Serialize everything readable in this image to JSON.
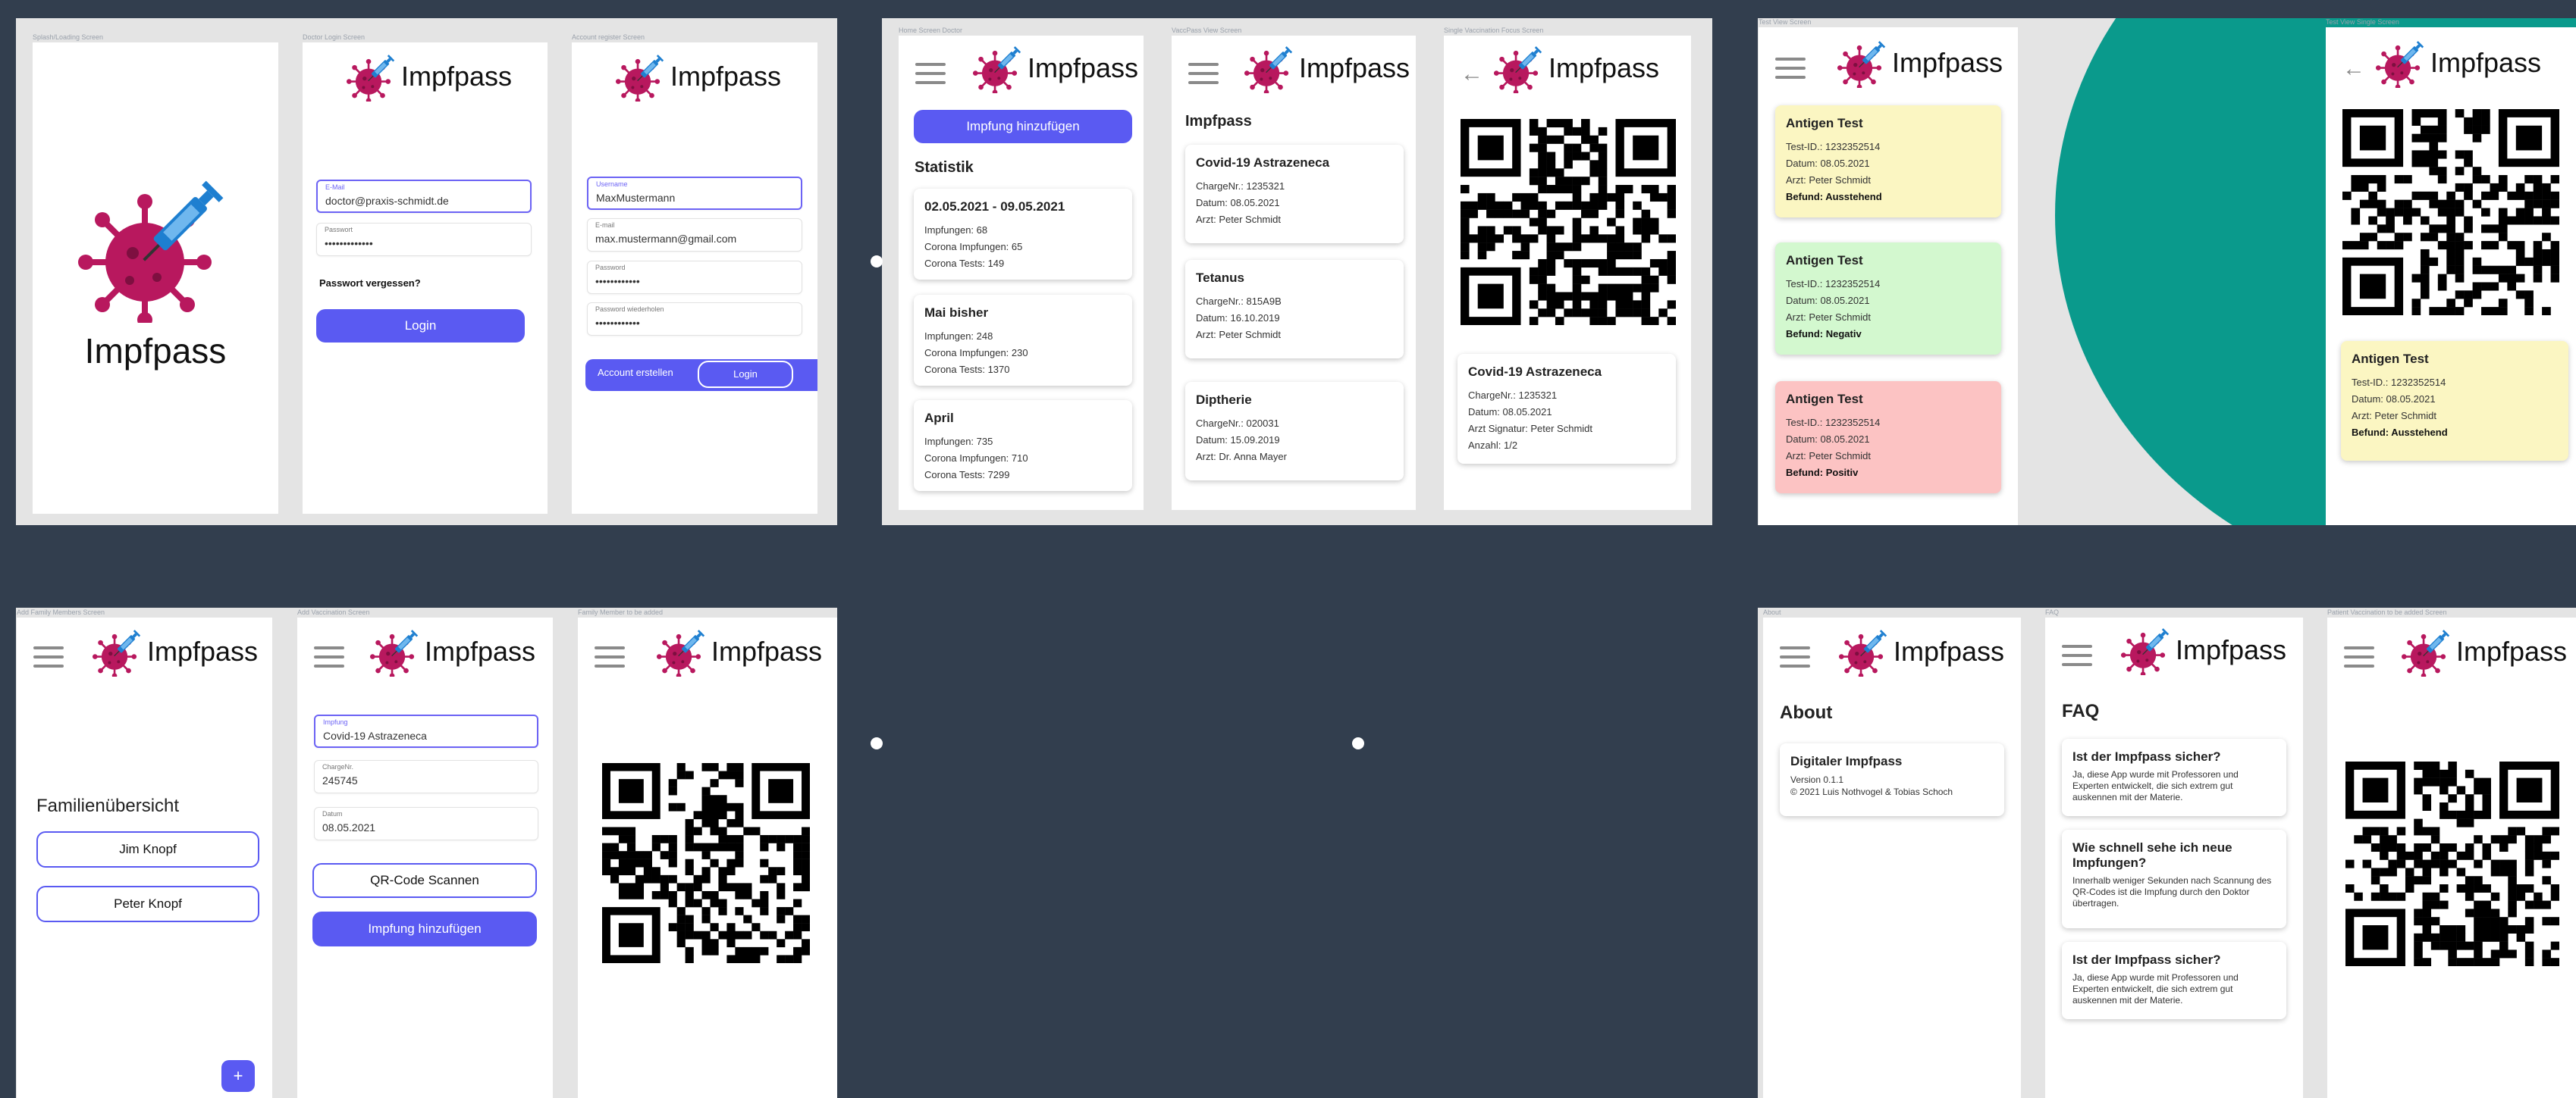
{
  "app_name": "Impfpass",
  "screens": {
    "splash": {
      "label": "Splash/Loading Screen",
      "title": "Impfpass"
    },
    "doctor_login": {
      "label": "Doctor Login Screen",
      "email_label": "E-Mail",
      "email_value": "doctor@praxis-schmidt.de",
      "password_label": "Passwort",
      "password_value": "•••••••••••••",
      "forgot": "Passwort vergessen?",
      "login": "Login"
    },
    "register": {
      "label": "Account register Screen",
      "username_label": "Username",
      "username_value": "MaxMustermann",
      "email_label": "E-mail",
      "email_value": "max.mustermann@gmail.com",
      "password_label": "Password",
      "password_value": "••••••••••••",
      "password2_label": "Password wiederholen",
      "password2_value": "••••••••••••",
      "create": "Account erstellen",
      "login": "Login"
    },
    "home": {
      "label": "Home Screen Doctor",
      "add_button": "Impfung hinzufügen",
      "stats_title": "Statistik",
      "cards": [
        {
          "title": "02.05.2021 - 09.05.2021",
          "lines": [
            "Impfungen: 68",
            "Corona Impfungen: 65",
            "Corona Tests: 149"
          ]
        },
        {
          "title": "Mai bisher",
          "lines": [
            "Impfungen: 248",
            "Corona Impfungen: 230",
            "Corona Tests: 1370"
          ]
        },
        {
          "title": "April",
          "lines": [
            "Impfungen: 735",
            "Corona Impfungen: 710",
            "Corona Tests: 7299"
          ]
        }
      ]
    },
    "vacc_view": {
      "label": "VaccPass View Screen",
      "title": "Impfpass",
      "cards": [
        {
          "title": "Covid-19 Astrazeneca",
          "lines": [
            "ChargeNr.: 1235321",
            "Datum: 08.05.2021",
            "Arzt: Peter Schmidt"
          ]
        },
        {
          "title": "Tetanus",
          "lines": [
            "ChargeNr.: 815A9B",
            "Datum: 16.10.2019",
            "Arzt: Peter Schmidt"
          ]
        },
        {
          "title": "Diptherie",
          "lines": [
            "ChargeNr.: 020031",
            "Datum: 15.09.2019",
            "Arzt: Dr. Anna Mayer"
          ]
        }
      ]
    },
    "single_vacc": {
      "label": "Single Vaccination Focus Screen",
      "card": {
        "title": "Covid-19 Astrazeneca",
        "lines": [
          "ChargeNr.: 1235321",
          "Datum: 08.05.2021",
          "Arzt Signatur: Peter Schmidt",
          "Anzahl: 1/2"
        ]
      }
    },
    "test_view": {
      "label": "Test View Screen",
      "cards": [
        {
          "title": "Antigen Test",
          "lines": [
            "Test-ID.:  1232352514",
            "Datum: 08.05.2021",
            "Arzt: Peter Schmidt"
          ],
          "result": "Befund: Ausstehend",
          "color": "#fbf6c2"
        },
        {
          "title": "Antigen Test",
          "lines": [
            "Test-ID.:  1232352514",
            "Datum: 08.05.2021",
            "Arzt: Peter Schmidt"
          ],
          "result": "Befund: Negativ",
          "color": "#d3f8cf"
        },
        {
          "title": "Antigen Test",
          "lines": [
            "Test-ID.:  1232352514",
            "Datum: 08.05.2021",
            "Arzt: Peter Schmidt"
          ],
          "result": "Befund: Positiv",
          "color": "#fcc3c3"
        }
      ]
    },
    "test_single": {
      "label": "Test View Single Screen",
      "card": {
        "title": "Antigen Test",
        "lines": [
          "Test-ID.:  1232352514",
          "Datum: 08.05.2021",
          "Arzt: Peter Schmidt"
        ],
        "result": "Befund: Ausstehend"
      }
    },
    "family": {
      "label": "Add Family Members Screen",
      "title": "Familienübersicht",
      "members": [
        "Jim Knopf",
        "Peter Knopf"
      ],
      "fab": "+"
    },
    "add_vacc": {
      "label": "Add Vaccination Screen",
      "impfung_label": "Impfung",
      "impfung_value": "Covid-19 Astrazeneca",
      "charge_label": "ChargeNr.",
      "charge_value": "245745",
      "datum_label": "Datum",
      "datum_value": "08.05.2021",
      "scan": "QR-Code Scannen",
      "add": "Impfung hinzufügen"
    },
    "family_add": {
      "label": "Family Member to be added"
    },
    "about": {
      "label": "About",
      "title": "About",
      "card_title": "Digitaler Impfpass",
      "lines": [
        "Version 0.1.1",
        "© 2021 Luis Nothvogel & Tobias Schoch"
      ]
    },
    "faq": {
      "label": "FAQ",
      "title": "FAQ",
      "items": [
        {
          "q": "Ist der Impfpass sicher?",
          "a": "Ja, diese App wurde mit Professoren und Experten entwickelt, die sich extrem gut auskennen mit der Materie."
        },
        {
          "q": "Wie schnell sehe ich neue Impfungen?",
          "a": "Innerhalb weniger Sekunden nach Scannung des QR-Codes ist die Impfung durch den Doktor übertragen."
        },
        {
          "q": "Ist der Impfpass sicher?",
          "a": "Ja, diese App wurde mit Professoren und Experten entwickelt, die sich extrem gut auskennen mit der Materie."
        }
      ]
    },
    "patient_vacc": {
      "label": "Patient Vaccination to be added Screen"
    }
  },
  "colors": {
    "accent": "#5a5af2",
    "background": "#323e4e",
    "virus": "#b8185e",
    "syringe": "#1e7fd0",
    "teal": "#0a9a8c"
  },
  "icons": [
    "logo-virus-syringe-icon",
    "menu-icon",
    "back-arrow-icon",
    "qr-code-icon",
    "plus-icon"
  ]
}
